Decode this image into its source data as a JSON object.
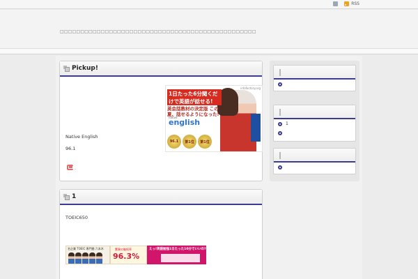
{
  "topbar": {
    "rss_label": "RSS"
  },
  "header": {
    "description": "□□□□□□□□□□□□□□□□□□□□□□□□□□□□□□□□□□□□□□□□□□□□□□□□"
  },
  "posts": [
    {
      "title": "Pickup!",
      "banner": {
        "tag": "infofactory.org",
        "headline": "1日たった6分聞くだけで英語が話せる!",
        "subline": "英会話教材の決定版 この夏、話せるようになった!",
        "native": "native",
        "logo": "english",
        "medal_1": "96.1",
        "medal_2": "第1位",
        "medal_3": "第1位"
      },
      "product_name": "Native English",
      "score": "96.1",
      "link_suffix": "."
    },
    {
      "title": "1",
      "body": "TOEIC650",
      "banner": {
        "left_title": "名企業 TOEIC 専門塾 六本木",
        "rate_label": "驚異の継続率",
        "rate": "96.3%",
        "question": "えっ!英語勉強1日たった10分でいいの?"
      }
    }
  ],
  "sidebar": {
    "widgets": [
      {
        "items": [
          ""
        ]
      },
      {
        "items": [
          "1",
          ""
        ]
      },
      {
        "items": [
          ""
        ]
      }
    ]
  },
  "colors": {
    "accent": "#3b3b8f",
    "banner_red": "#d82b1f",
    "banner_pink": "#d1156b"
  }
}
